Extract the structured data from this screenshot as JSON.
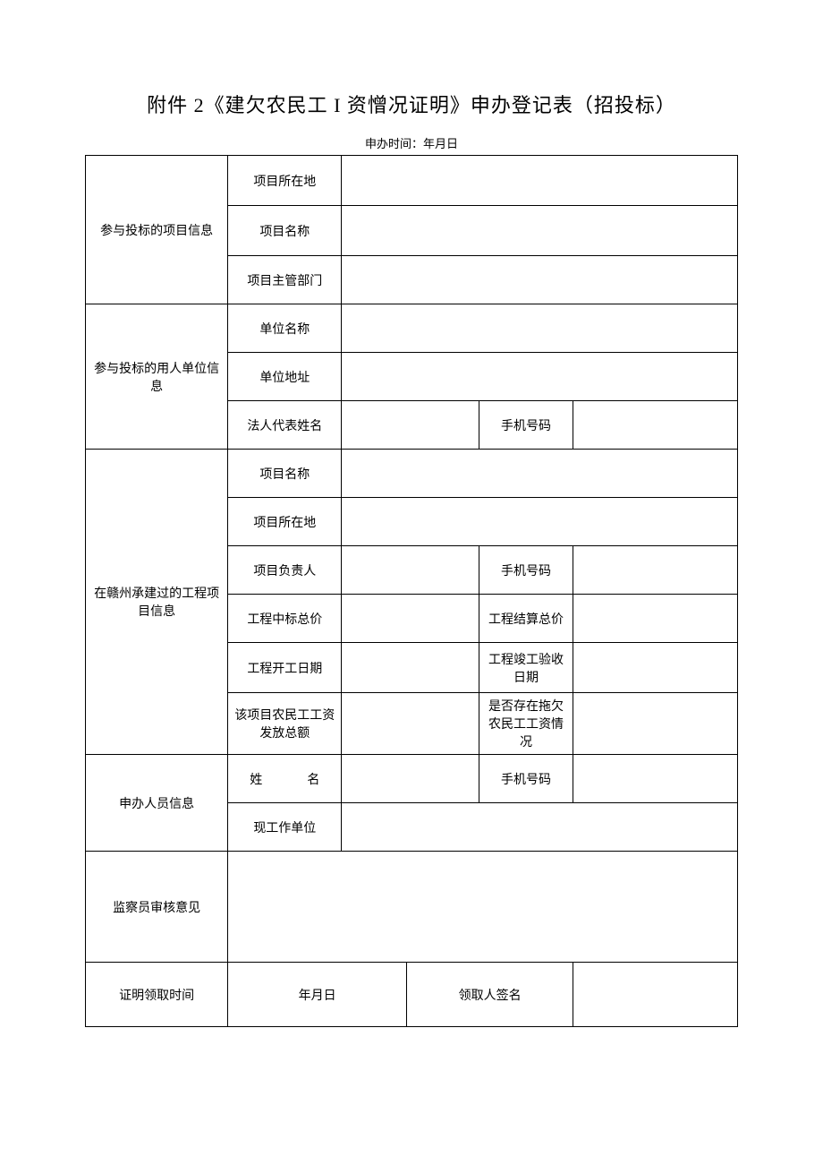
{
  "title": "附件 2《建欠农民工 I 资憎况证明》申办登记表（招投标）",
  "subtitle": "申办时间：年月日",
  "sections": {
    "bid_project": {
      "header": "参与投标的项目信息",
      "rows": {
        "location": {
          "label": "项目所在地",
          "value": ""
        },
        "name": {
          "label": "项目名称",
          "value": ""
        },
        "department": {
          "label": "项目主管部门",
          "value": ""
        }
      }
    },
    "employer": {
      "header": "参与投标的用人单位信息",
      "rows": {
        "unit_name": {
          "label": "单位名称",
          "value": ""
        },
        "unit_address": {
          "label": "单位地址",
          "value": ""
        },
        "legal_rep": {
          "label": "法人代表姓名",
          "value": "",
          "phone_label": "手机号码",
          "phone_value": ""
        }
      }
    },
    "ganzhou_project": {
      "header": "在赣州承建过的工程项目信息",
      "rows": {
        "proj_name": {
          "label": "项目名称",
          "value": ""
        },
        "proj_location": {
          "label": "项目所在地",
          "value": ""
        },
        "proj_leader": {
          "label": "项目负责人",
          "value": "",
          "label2": "手机号码",
          "value2": ""
        },
        "bid_total": {
          "label": "工程中标总价",
          "value": "",
          "label2": "工程结算总价",
          "value2": ""
        },
        "start_date": {
          "label": "工程开工日期",
          "value": "",
          "label2": "工程竣工验收日期",
          "value2": ""
        },
        "wage_total": {
          "label": "该项目农民工工资发放总额",
          "value": "",
          "label2": "是否存在拖欠农民工工资情况",
          "value2": ""
        }
      }
    },
    "applicant": {
      "header": "申办人员信息",
      "rows": {
        "name": {
          "label_a": "姓",
          "label_b": "名",
          "value": "",
          "phone_label": "手机号码",
          "phone_value": ""
        },
        "work_unit": {
          "label": "现工作单位",
          "value": ""
        }
      }
    },
    "inspector": {
      "header": "监察员审核意见",
      "value": ""
    },
    "pickup": {
      "time_label": "证明领取时间",
      "time_value": "年月日",
      "signer_label": "领取人签名",
      "signer_value": ""
    }
  }
}
